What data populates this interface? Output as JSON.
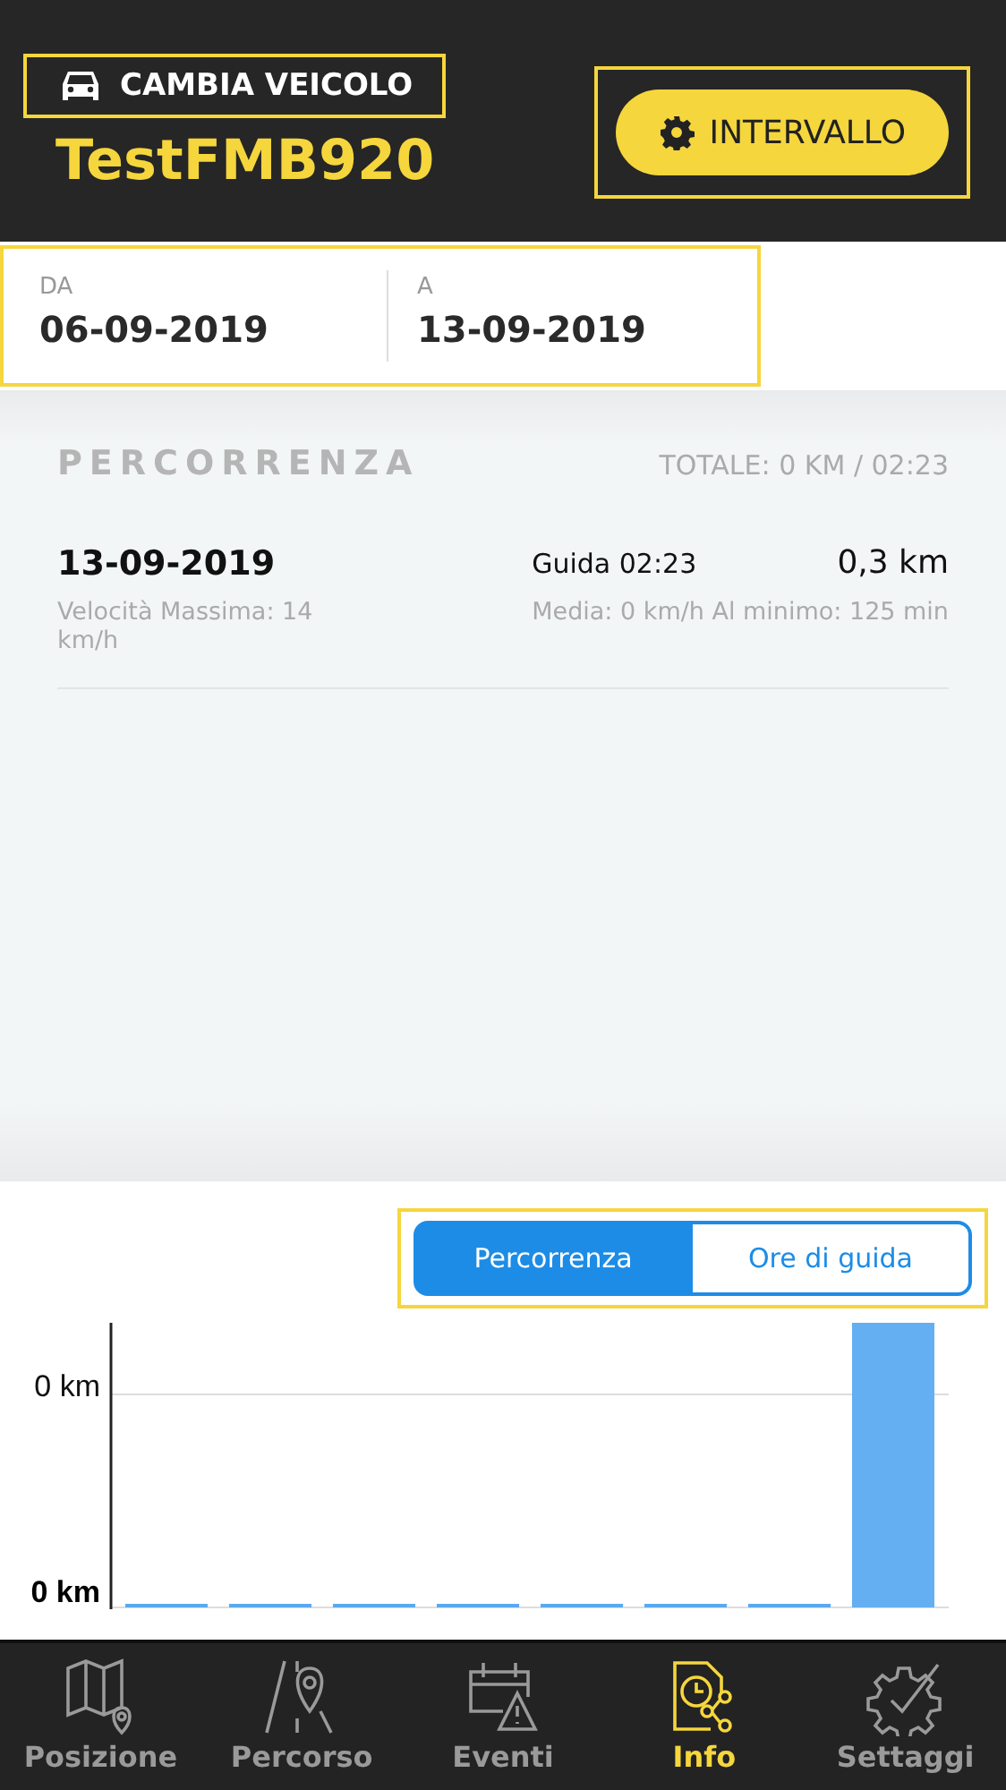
{
  "header": {
    "change_vehicle": {
      "label": "CAMBIA VEICOLO",
      "highlighted": true
    },
    "vehicle_name": "TestFMB920",
    "interval_button": {
      "label": "INTERVALLO",
      "highlighted": true
    }
  },
  "date_range": {
    "highlighted": true,
    "from": {
      "label": "DA",
      "value": "06-09-2019"
    },
    "to": {
      "label": "A",
      "value": "13-09-2019"
    }
  },
  "summary": {
    "title": "PERCORRENZA",
    "total": "TOTALE: 0 KM / 02:23"
  },
  "trips": [
    {
      "date": "13-09-2019",
      "driving": "Guida 02:23",
      "distance": "0,3 km",
      "max_speed": "Velocità Massima: 14 km/h",
      "details": "Media: 0 km/h Al minimo: 125 min"
    }
  ],
  "chart_toggle": {
    "highlighted": true,
    "options": [
      {
        "label": "Percorrenza",
        "selected": true
      },
      {
        "label": "Ore di guida",
        "selected": false
      }
    ]
  },
  "chart": {
    "y_labels": [
      "0 km",
      "0 km"
    ]
  },
  "nav": [
    {
      "label": "Posizione",
      "kind": "map",
      "selected": false
    },
    {
      "label": "Percorso",
      "kind": "route",
      "selected": false
    },
    {
      "label": "Eventi",
      "kind": "events",
      "selected": false
    },
    {
      "label": "Info",
      "kind": "info",
      "selected": true
    },
    {
      "label": "Settaggi",
      "kind": "settings",
      "selected": false
    }
  ]
}
